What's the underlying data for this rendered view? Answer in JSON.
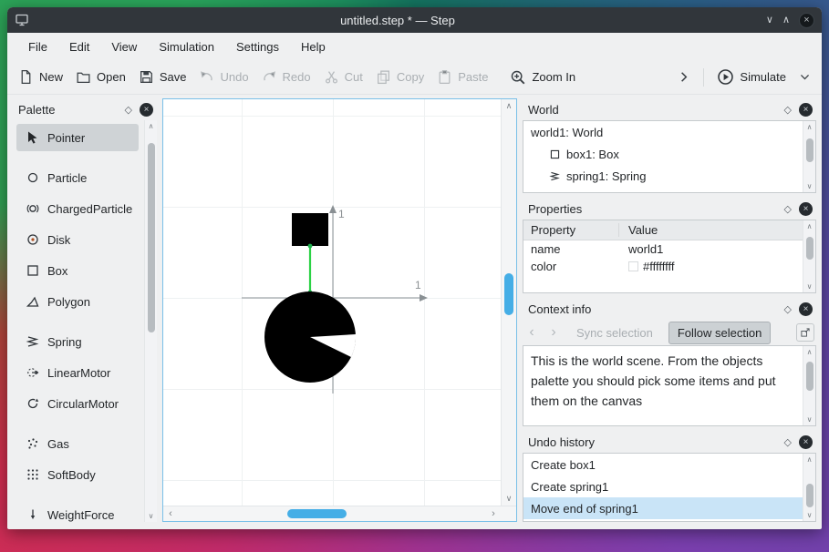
{
  "icons": {
    "chevron_up": "∧",
    "chevron_down": "∨",
    "chevron_left": "‹",
    "chevron_right": "›",
    "float_diamond": "◇",
    "close_x": "×"
  },
  "window": {
    "title": "untitled.step * — Step"
  },
  "menubar": {
    "items": [
      {
        "label": "File"
      },
      {
        "label": "Edit"
      },
      {
        "label": "View"
      },
      {
        "label": "Simulation"
      },
      {
        "label": "Settings"
      },
      {
        "label": "Help"
      }
    ]
  },
  "toolbar": {
    "new": "New",
    "open": "Open",
    "save": "Save",
    "undo": "Undo",
    "redo": "Redo",
    "cut": "Cut",
    "copy": "Copy",
    "paste": "Paste",
    "zoom_in": "Zoom In",
    "simulate": "Simulate"
  },
  "palette": {
    "title": "Palette",
    "items": [
      {
        "label": "Pointer",
        "selected": true
      },
      {
        "label": "Particle"
      },
      {
        "label": "ChargedParticle"
      },
      {
        "label": "Disk"
      },
      {
        "label": "Box"
      },
      {
        "label": "Polygon"
      },
      {
        "label": "Spring"
      },
      {
        "label": "LinearMotor"
      },
      {
        "label": "CircularMotor"
      },
      {
        "label": "Gas"
      },
      {
        "label": "SoftBody"
      },
      {
        "label": "WeightForce"
      }
    ]
  },
  "canvas": {
    "x_axis_label": "1",
    "y_axis_label": "1"
  },
  "panels": {
    "world": {
      "title": "World",
      "tree": [
        {
          "label": "world1: World"
        },
        {
          "label": "box1: Box"
        },
        {
          "label": "spring1: Spring"
        }
      ]
    },
    "properties": {
      "title": "Properties",
      "columns": {
        "property": "Property",
        "value": "Value"
      },
      "rows": [
        {
          "property": "name",
          "value": "world1"
        },
        {
          "property": "color",
          "value": "#ffffffff"
        }
      ]
    },
    "context": {
      "title": "Context info",
      "sync_button": "Sync selection",
      "follow_button": "Follow selection",
      "body": "This is the world scene. From the objects palette you should pick some items and put them on the canvas"
    },
    "undo": {
      "title": "Undo history",
      "items": [
        {
          "label": "Create box1"
        },
        {
          "label": "Create spring1"
        },
        {
          "label": "Move end of spring1",
          "selected": true
        }
      ]
    }
  },
  "colors": {
    "accent": "#3daee9",
    "selection": "#c9e4f7",
    "titlebar": "#31363b",
    "window_bg": "#eff0f1",
    "spring_green": "#2bd245"
  }
}
